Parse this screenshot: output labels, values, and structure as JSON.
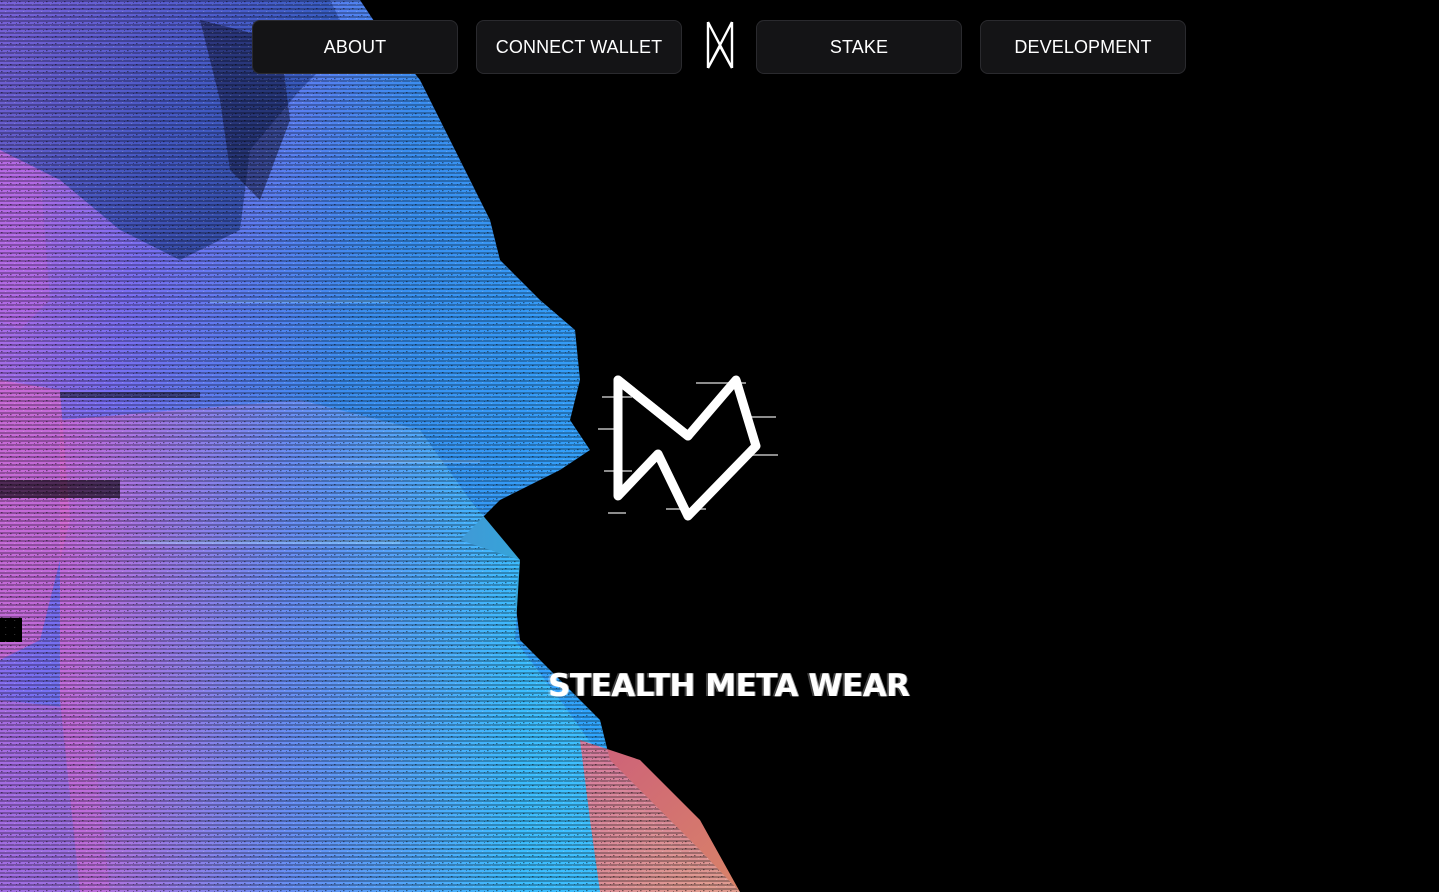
{
  "nav": {
    "about_label": "ABOUT",
    "connect_wallet_label": "CONNECT WALLET",
    "stake_label": "STAKE",
    "development_label": "DEVELOPMENT",
    "logo_icon": "smw-monogram-icon"
  },
  "hero": {
    "logo_icon": "smw-glitch-logo-icon",
    "title": "STEALTH META WEAR",
    "art": "glitch-gradient-art"
  },
  "colors": {
    "background": "#000000",
    "button_bg": "#141416",
    "button_text": "#ffffff",
    "art_blue": "#3aa0f0",
    "art_cyan": "#3fc6ff",
    "art_violet": "#9a6cf0",
    "art_pink": "#e05ab8",
    "art_coral": "#f06a88"
  }
}
